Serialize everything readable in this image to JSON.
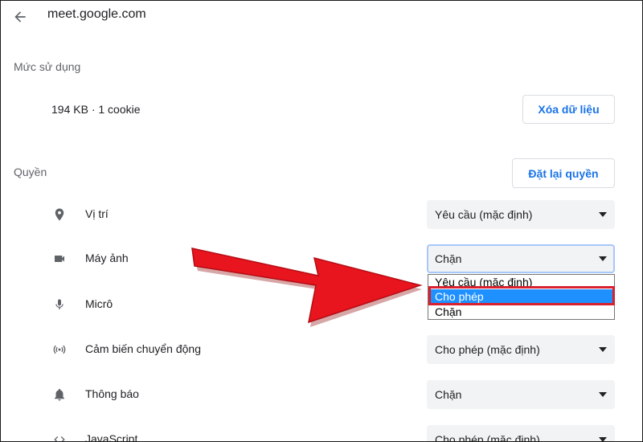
{
  "header": {
    "back_icon": "arrow-left-icon",
    "site": "meet.google.com"
  },
  "usage": {
    "label": "Mức sử dụng",
    "text": "194 KB · 1 cookie",
    "clear_button": "Xóa dữ liệu"
  },
  "permissions": {
    "label": "Quyền",
    "reset_button": "Đặt lại quyền",
    "items": [
      {
        "icon": "location-pin-icon",
        "label": "Vị trí",
        "value": "Yêu cầu (mặc định)"
      },
      {
        "icon": "camera-icon",
        "label": "Máy ảnh",
        "value": "Chặn"
      },
      {
        "icon": "microphone-icon",
        "label": "Micrô",
        "value": ""
      },
      {
        "icon": "motion-sensor-icon",
        "label": "Cảm biến chuyển động",
        "value": "Cho phép (mặc định)"
      },
      {
        "icon": "bell-icon",
        "label": "Thông báo",
        "value": "Chặn"
      },
      {
        "icon": "code-icon",
        "label": "JavaScript",
        "value": "Cho phép (mặc định)"
      }
    ]
  },
  "dropdown": {
    "options": [
      "Yêu cầu (mặc định)",
      "Cho phép",
      "Chặn"
    ],
    "highlighted": "Cho phép"
  },
  "colors": {
    "accent": "#1a73e8",
    "select_bg": "#f1f3f4",
    "highlight_option": "#1e90ff",
    "annotation_red": "#e8141e"
  }
}
